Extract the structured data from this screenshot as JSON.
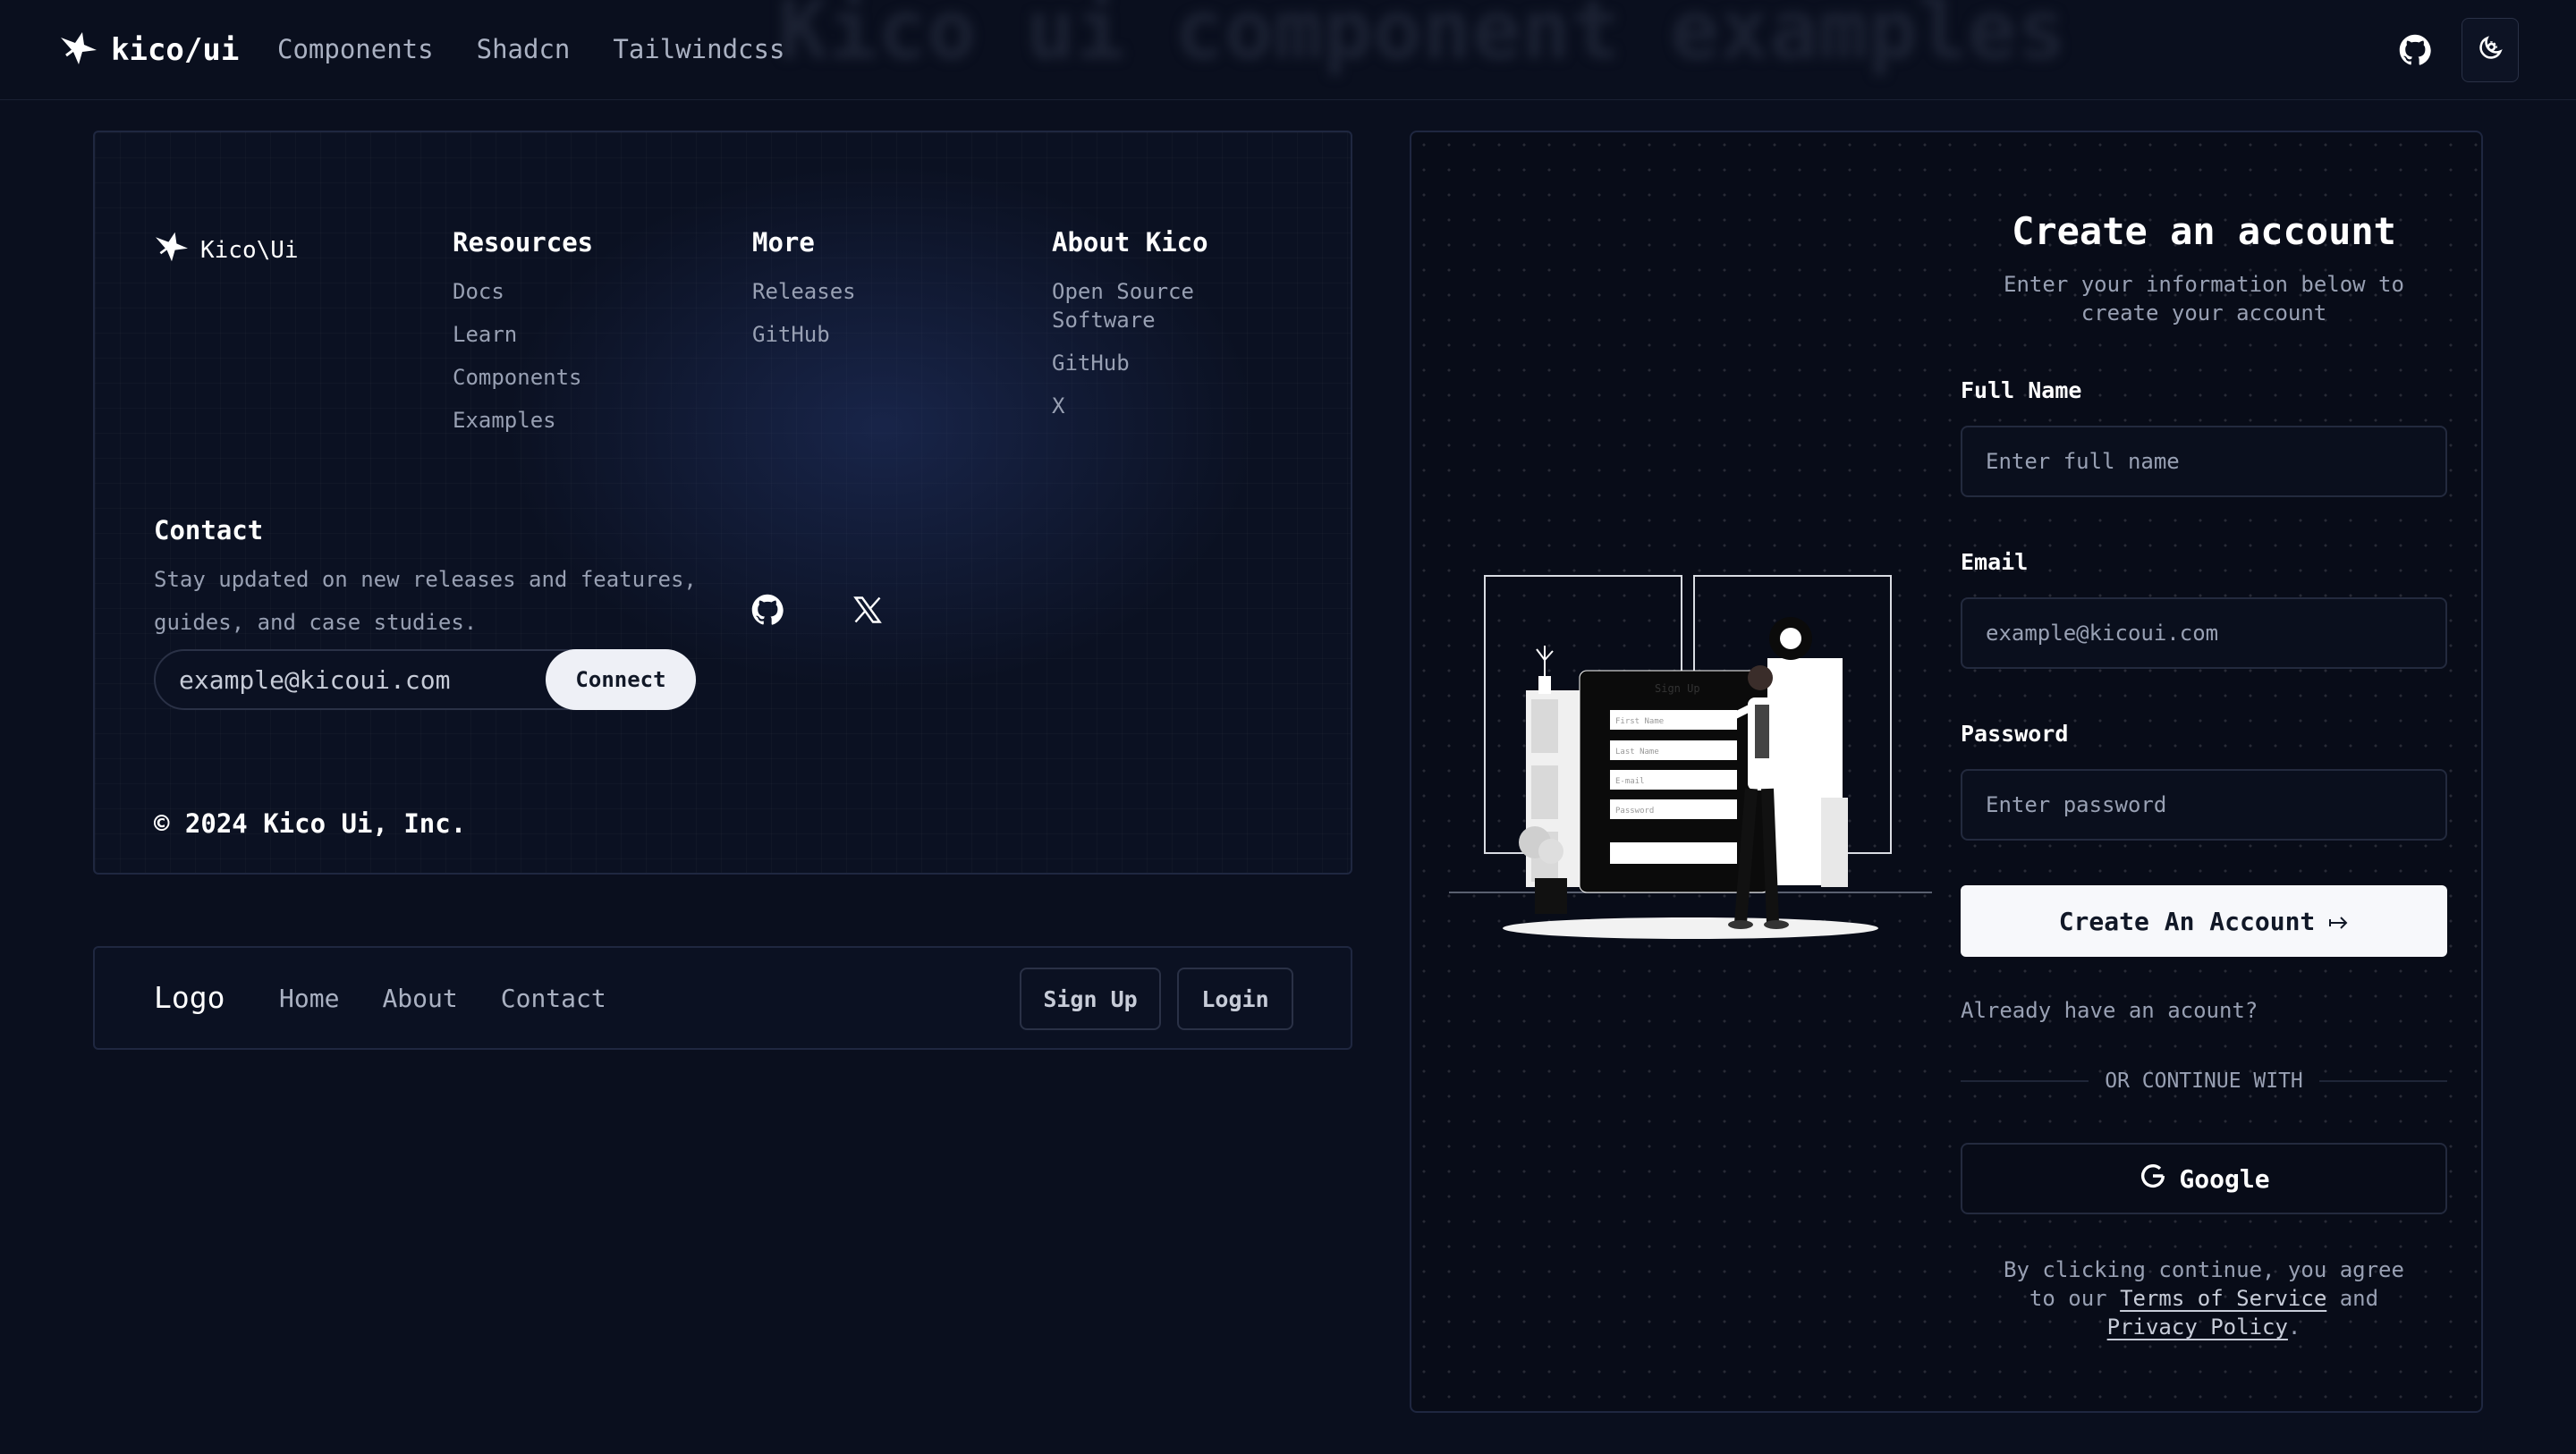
{
  "topnav": {
    "brand": "kico/ui",
    "links": [
      "Components",
      "Shadcn",
      "Tailwindcss"
    ],
    "ghost_title": "Kico ui component examples"
  },
  "footer": {
    "logo_text": "Kico\\Ui",
    "columns": [
      {
        "title": "Resources",
        "links": [
          "Docs",
          "Learn",
          "Components",
          "Examples"
        ]
      },
      {
        "title": "More",
        "links": [
          "Releases",
          "GitHub"
        ]
      },
      {
        "title": "About Kico",
        "links": [
          "Open Source Software",
          "GitHub",
          "X"
        ]
      }
    ],
    "contact_title": "Contact",
    "contact_text": "Stay updated on new releases and features, guides, and case studies.",
    "email_placeholder": "example@kicoui.com",
    "connect_label": "Connect",
    "copyright": "© 2024 Kico Ui, Inc."
  },
  "mini_nav": {
    "logo": "Logo",
    "links": [
      "Home",
      "About",
      "Contact"
    ],
    "signup_label": "Sign Up",
    "login_label": "Login"
  },
  "signup": {
    "title": "Create an account",
    "subtitle": "Enter your information below to create your account",
    "fullname_label": "Full Name",
    "fullname_placeholder": "Enter full name",
    "email_label": "Email",
    "email_placeholder": "example@kicoui.com",
    "password_label": "Password",
    "password_placeholder": "Enter password",
    "create_label": "Create An Account",
    "already": "Already have an acount?",
    "or_continue": "OR CONTINUE WITH",
    "google_label": "Google",
    "terms_prefix": "By clicking continue, you agree to our",
    "terms_link": "Terms of Service",
    "terms_and": "and",
    "privacy_link": "Privacy Policy",
    "terms_end": ".",
    "illustration": {
      "heading": "Sign Up",
      "fields": [
        "First Name",
        "Last Name",
        "E-mail",
        "Password"
      ]
    }
  },
  "colors": {
    "background": "#0a0f1e",
    "card_border": "#1f2740",
    "primary_button": "#f7f8fb",
    "muted_text": "#98a0b3"
  }
}
